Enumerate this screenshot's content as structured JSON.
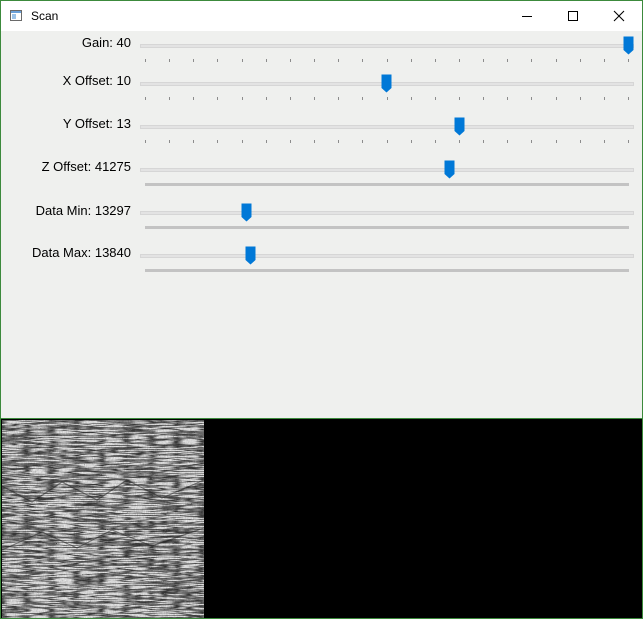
{
  "window": {
    "title": "Scan",
    "icon": "window-app-icon",
    "controls": [
      "minimize-icon",
      "maximize-icon",
      "close-icon"
    ]
  },
  "sliders": [
    {
      "label": "Gain: 40",
      "value_fraction": 1.0
    },
    {
      "label": "X Offset: 10",
      "value_fraction": 0.5
    },
    {
      "label": "Y Offset: 13",
      "value_fraction": 0.65
    },
    {
      "label": "Z Offset: 41275",
      "value_fraction": 0.63
    },
    {
      "label": "Data Min: 13297",
      "value_fraction": 0.21
    },
    {
      "label": "Data Max: 13840",
      "value_fraction": 0.22
    }
  ],
  "colors": {
    "accent": "#0078d7",
    "window_border": "#3c8a3c",
    "panel_bg": "#eff0ee",
    "image_bg": "#000000"
  }
}
